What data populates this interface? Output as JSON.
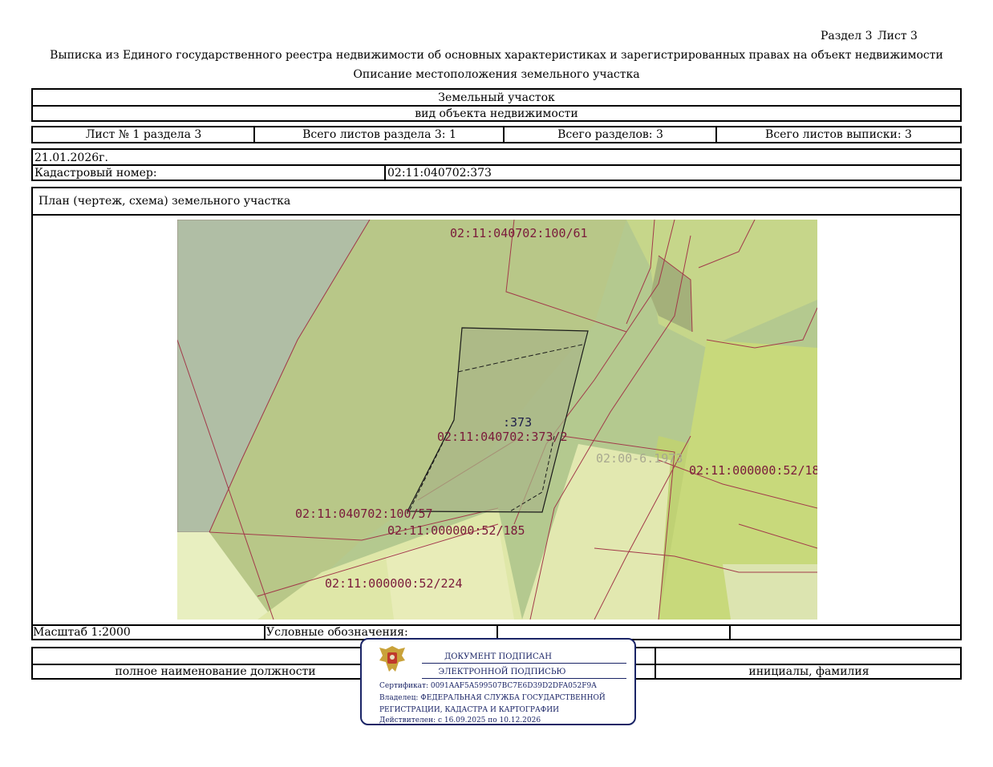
{
  "header": {
    "section_label": "Раздел 3",
    "sheet_label": "Лист 3",
    "title": "Выписка из Единого государственного реестра недвижимости об основных характеристиках и зарегистрированных правах на объект недвижимости",
    "subtitle": "Описание местоположения земельного участка"
  },
  "object": {
    "type": "Земельный участок",
    "type_caption": "вид объекта недвижимости"
  },
  "sheets": {
    "sheet_no": "Лист № 1 раздела 3",
    "total_sheets_section": "Всего листов раздела 3: 1",
    "total_sections": "Всего разделов: 3",
    "total_sheets_extract": "Всего листов выписки: 3"
  },
  "date": "21.01.2026г.",
  "cadastral": {
    "label": "Кадастровый номер:",
    "value": "02:11:040702:373"
  },
  "plan": {
    "title": "План (чертеж, схема) земельного участка",
    "labels": {
      "l1": "02:11:040702:100/61",
      "l2": ":373",
      "l3": "02:11:040702:373/2",
      "l4": "02:00-6.1973",
      "l5": "02:11:000000:52/18",
      "l6": "02:11:040702:100/57",
      "l7": "02:11:000000:52/185",
      "l8": "02:11:000000:52/224"
    }
  },
  "legend": {
    "scale": "Масштаб 1:2000",
    "legend_label": "Условные обозначения:"
  },
  "footer": {
    "position_caption": "полное наименование должности",
    "name_caption": "инициалы, фамилия"
  },
  "signature": {
    "line1": "ДОКУМЕНТ ПОДПИСАН",
    "line2": "ЭЛЕКТРОННОЙ ПОДПИСЬЮ",
    "certificate": "Сертификат: 0091AAF5A599507BC7E6D39D2DFA052F9A",
    "owner1": "Владелец: ФЕДЕРАЛЬНАЯ СЛУЖБА ГОСУДАРСТВЕННОЙ",
    "owner2": "РЕГИСТРАЦИИ, КАДАСТРА И КАРТОГРАФИИ",
    "valid": "Действителен: с 16.09.2025 по 10.12.2026"
  }
}
